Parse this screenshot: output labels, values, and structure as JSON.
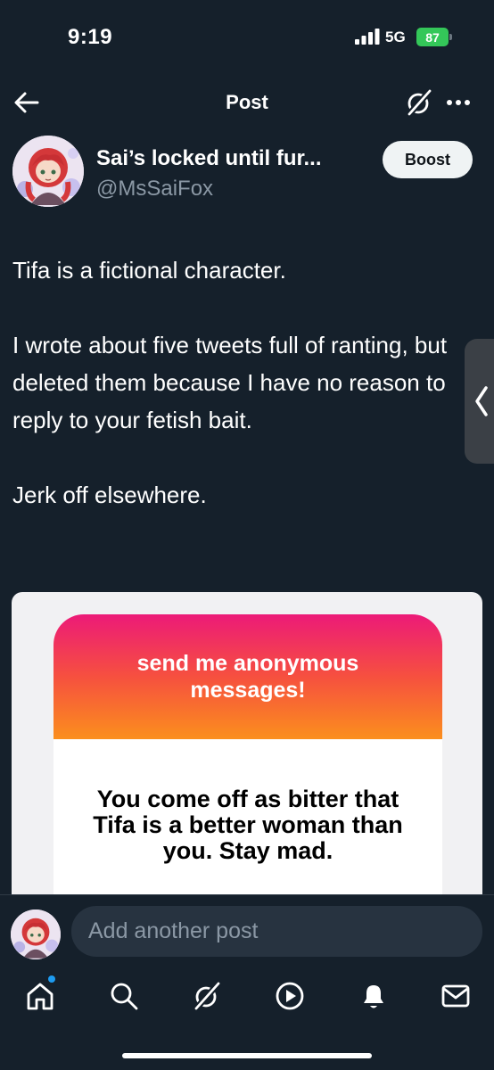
{
  "status_bar": {
    "time": "9:19",
    "network": "5G",
    "battery": "87"
  },
  "header": {
    "title": "Post",
    "back_icon": "arrow-left-icon",
    "grok_icon": "grok-icon",
    "more_icon": "more-horizontal-icon"
  },
  "author": {
    "display_name": "Sai’s locked until fur...",
    "handle": "@MsSaiFox",
    "boost_label": "Boost"
  },
  "post": {
    "paragraphs": [
      "Tifa is a fictional character.",
      "I wrote about five tweets full of ranting, but deleted them because I have no reason to reply to your fetish bait.",
      "Jerk off elsewhere."
    ]
  },
  "media": {
    "card_header": "send me anonymous messages!",
    "card_message": "You come off as bitter that Tifa is a better woman than you. Stay mad."
  },
  "compose": {
    "placeholder": "Add another post"
  },
  "bottom_nav": {
    "items": [
      "home-icon",
      "search-icon",
      "grok-icon",
      "video-icon",
      "notifications-icon",
      "messages-icon"
    ]
  },
  "colors": {
    "background": "#15202b",
    "secondary_text": "#8b98a5",
    "accent": "#1d9bf0",
    "battery": "#34c759"
  }
}
